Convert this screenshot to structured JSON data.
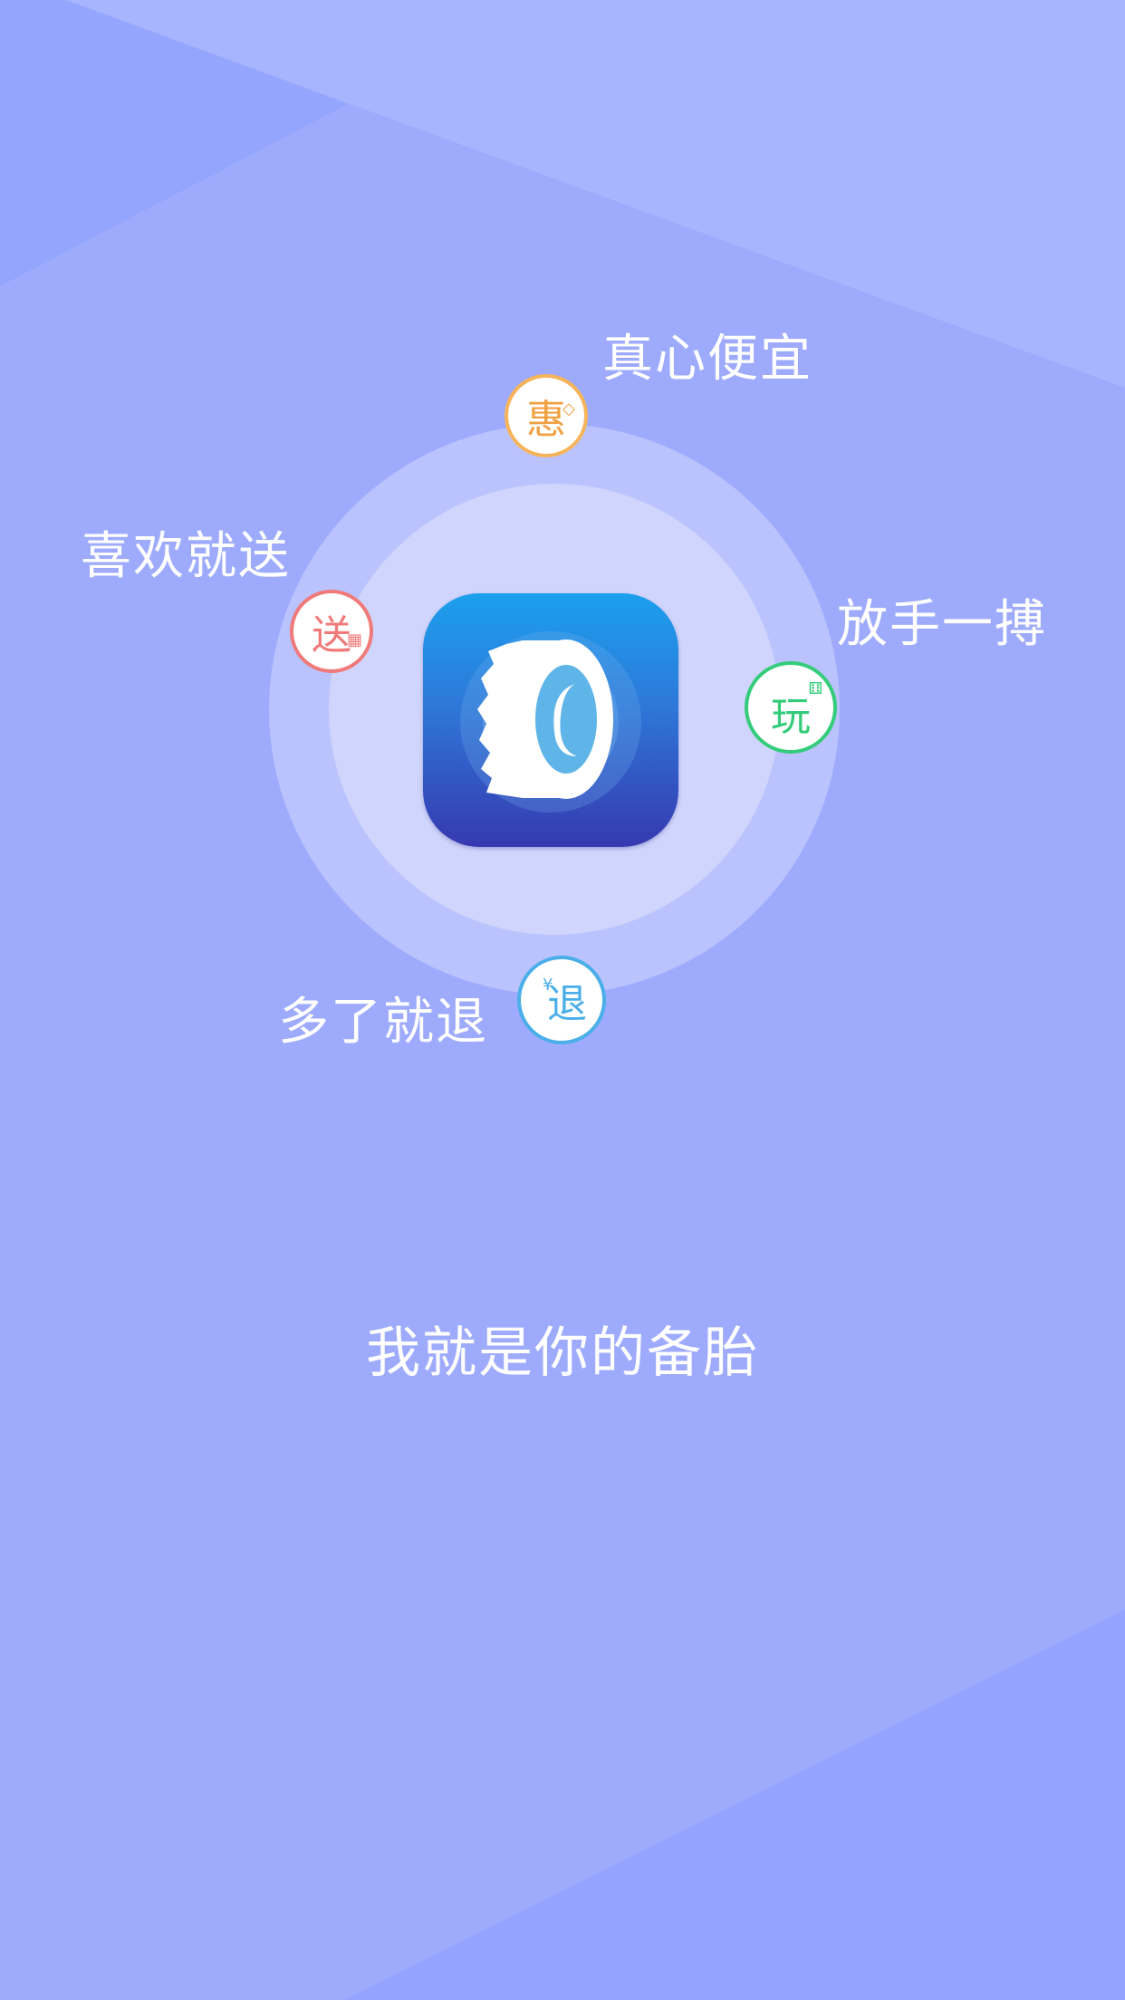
{
  "colors": {
    "background": "#9eabfd",
    "accent_hui": "#f6b45a",
    "accent_song": "#f07a7a",
    "accent_wan": "#34cc7a",
    "accent_tui": "#4aaee8"
  },
  "app_icon": {
    "icon": "tire-icon"
  },
  "features": [
    {
      "badge": "惠",
      "label": "真心便宜",
      "icon": "price-tag-icon"
    },
    {
      "badge": "送",
      "label": "喜欢就送",
      "icon": "gift-icon"
    },
    {
      "badge": "玩",
      "label": "放手一搏",
      "icon": "dice-icon"
    },
    {
      "badge": "退",
      "label": "多了就退",
      "icon": "yen-icon"
    }
  ],
  "slogan": "我就是你的备胎"
}
